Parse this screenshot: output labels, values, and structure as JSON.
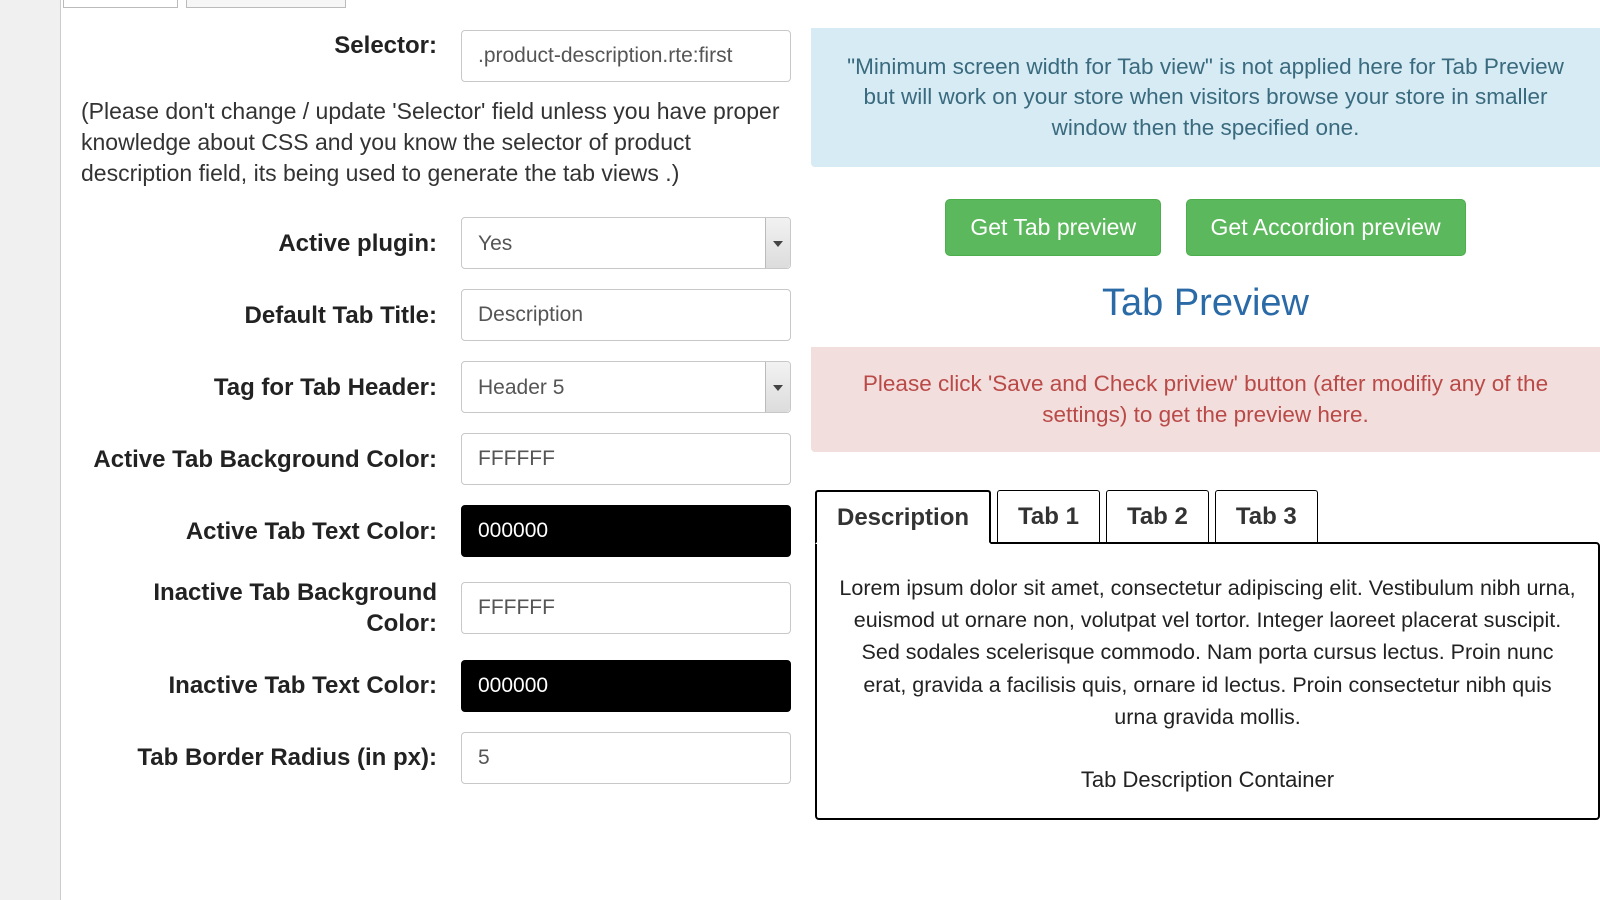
{
  "form": {
    "selector": {
      "label": "Selector:",
      "value": ".product-description.rte:first"
    },
    "help_text": "(Please don't change / update 'Selector' field unless you have proper knowledge about CSS and you know the selector of product description field, its being used to generate the tab views .)",
    "active_plugin": {
      "label": "Active plugin:",
      "value": "Yes"
    },
    "default_tab_title": {
      "label": "Default Tab Title:",
      "value": "Description"
    },
    "tag_for_tab_header": {
      "label": "Tag for Tab Header:",
      "value": "Header 5"
    },
    "active_tab_bg": {
      "label": "Active Tab Background Color:",
      "value": "FFFFFF"
    },
    "active_tab_text": {
      "label": "Active Tab Text Color:",
      "value": "000000"
    },
    "inactive_tab_bg": {
      "label": "Inactive Tab Background Color:",
      "value": "FFFFFF"
    },
    "inactive_tab_text": {
      "label": "Inactive Tab Text Color:",
      "value": "000000"
    },
    "tab_border_radius": {
      "label": "Tab Border Radius (in px):",
      "value": "5"
    }
  },
  "right": {
    "info_alert": "\"Minimum screen width for Tab view\" is not applied here for Tab Preview but will work on your store when visitors browse your store in smaller window then the specified one.",
    "btn_tab": "Get Tab preview",
    "btn_accordion": "Get Accordion preview",
    "preview_title": "Tab Preview",
    "danger_alert": "Please click 'Save and Check priview' button (after modifiy any of the settings) to get the preview here.",
    "tabs": [
      "Description",
      "Tab 1",
      "Tab 2",
      "Tab 3"
    ],
    "tab_content": "Lorem ipsum dolor sit amet, consectetur adipiscing elit. Vestibulum nibh urna, euismod ut ornare non, volutpat vel tortor. Integer laoreet placerat suscipit. Sed sodales scelerisque commodo. Nam porta cursus lectus. Proin nunc erat, gravida a facilisis quis, ornare id lectus. Proin consectetur nibh quis urna gravida mollis.",
    "tab_caption": "Tab Description Container"
  }
}
